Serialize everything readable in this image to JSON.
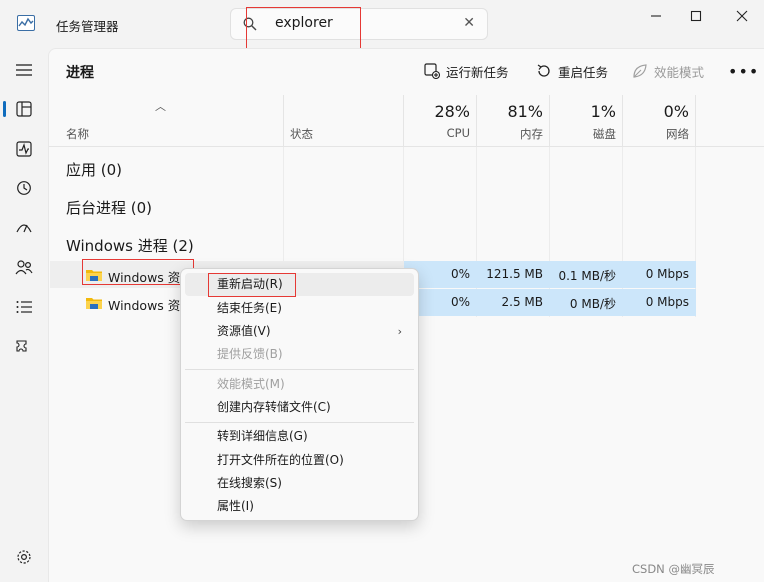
{
  "app": {
    "title": "任务管理器"
  },
  "search": {
    "value": "explorer"
  },
  "toolbar": {
    "page_title": "进程",
    "run_new_task": "运行新任务",
    "restart_task": "重启任务",
    "efficiency_mode": "效能模式"
  },
  "columns": {
    "name": "名称",
    "status": "状态",
    "cpu": {
      "pct": "28%",
      "label": "CPU"
    },
    "memory": {
      "pct": "81%",
      "label": "内存"
    },
    "disk": {
      "pct": "1%",
      "label": "磁盘"
    },
    "network": {
      "pct": "0%",
      "label": "网络"
    }
  },
  "groups": {
    "apps": "应用 (0)",
    "background": "后台进程 (0)",
    "windows": "Windows 进程 (2)"
  },
  "rows": [
    {
      "name": "Windows 资",
      "cpu": "0%",
      "memory": "121.5 MB",
      "disk": "0.1 MB/秒",
      "network": "0 Mbps"
    },
    {
      "name": "Windows 资",
      "cpu": "0%",
      "memory": "2.5 MB",
      "disk": "0 MB/秒",
      "network": "0 Mbps"
    }
  ],
  "context_menu": {
    "restart": "重新启动(R)",
    "end_task": "结束任务(E)",
    "resource_values": "资源值(V)",
    "provide_feedback": "提供反馈(B)",
    "efficiency_mode": "效能模式(M)",
    "create_dump": "创建内存转储文件(C)",
    "goto_details": "转到详细信息(G)",
    "open_location": "打开文件所在的位置(O)",
    "search_online": "在线搜索(S)",
    "properties": "属性(I)"
  },
  "watermark": "CSDN @幽冥辰",
  "colors": {
    "accent": "#0f6cbd",
    "selection": "#cce6fa",
    "highlight": "#e53935"
  }
}
